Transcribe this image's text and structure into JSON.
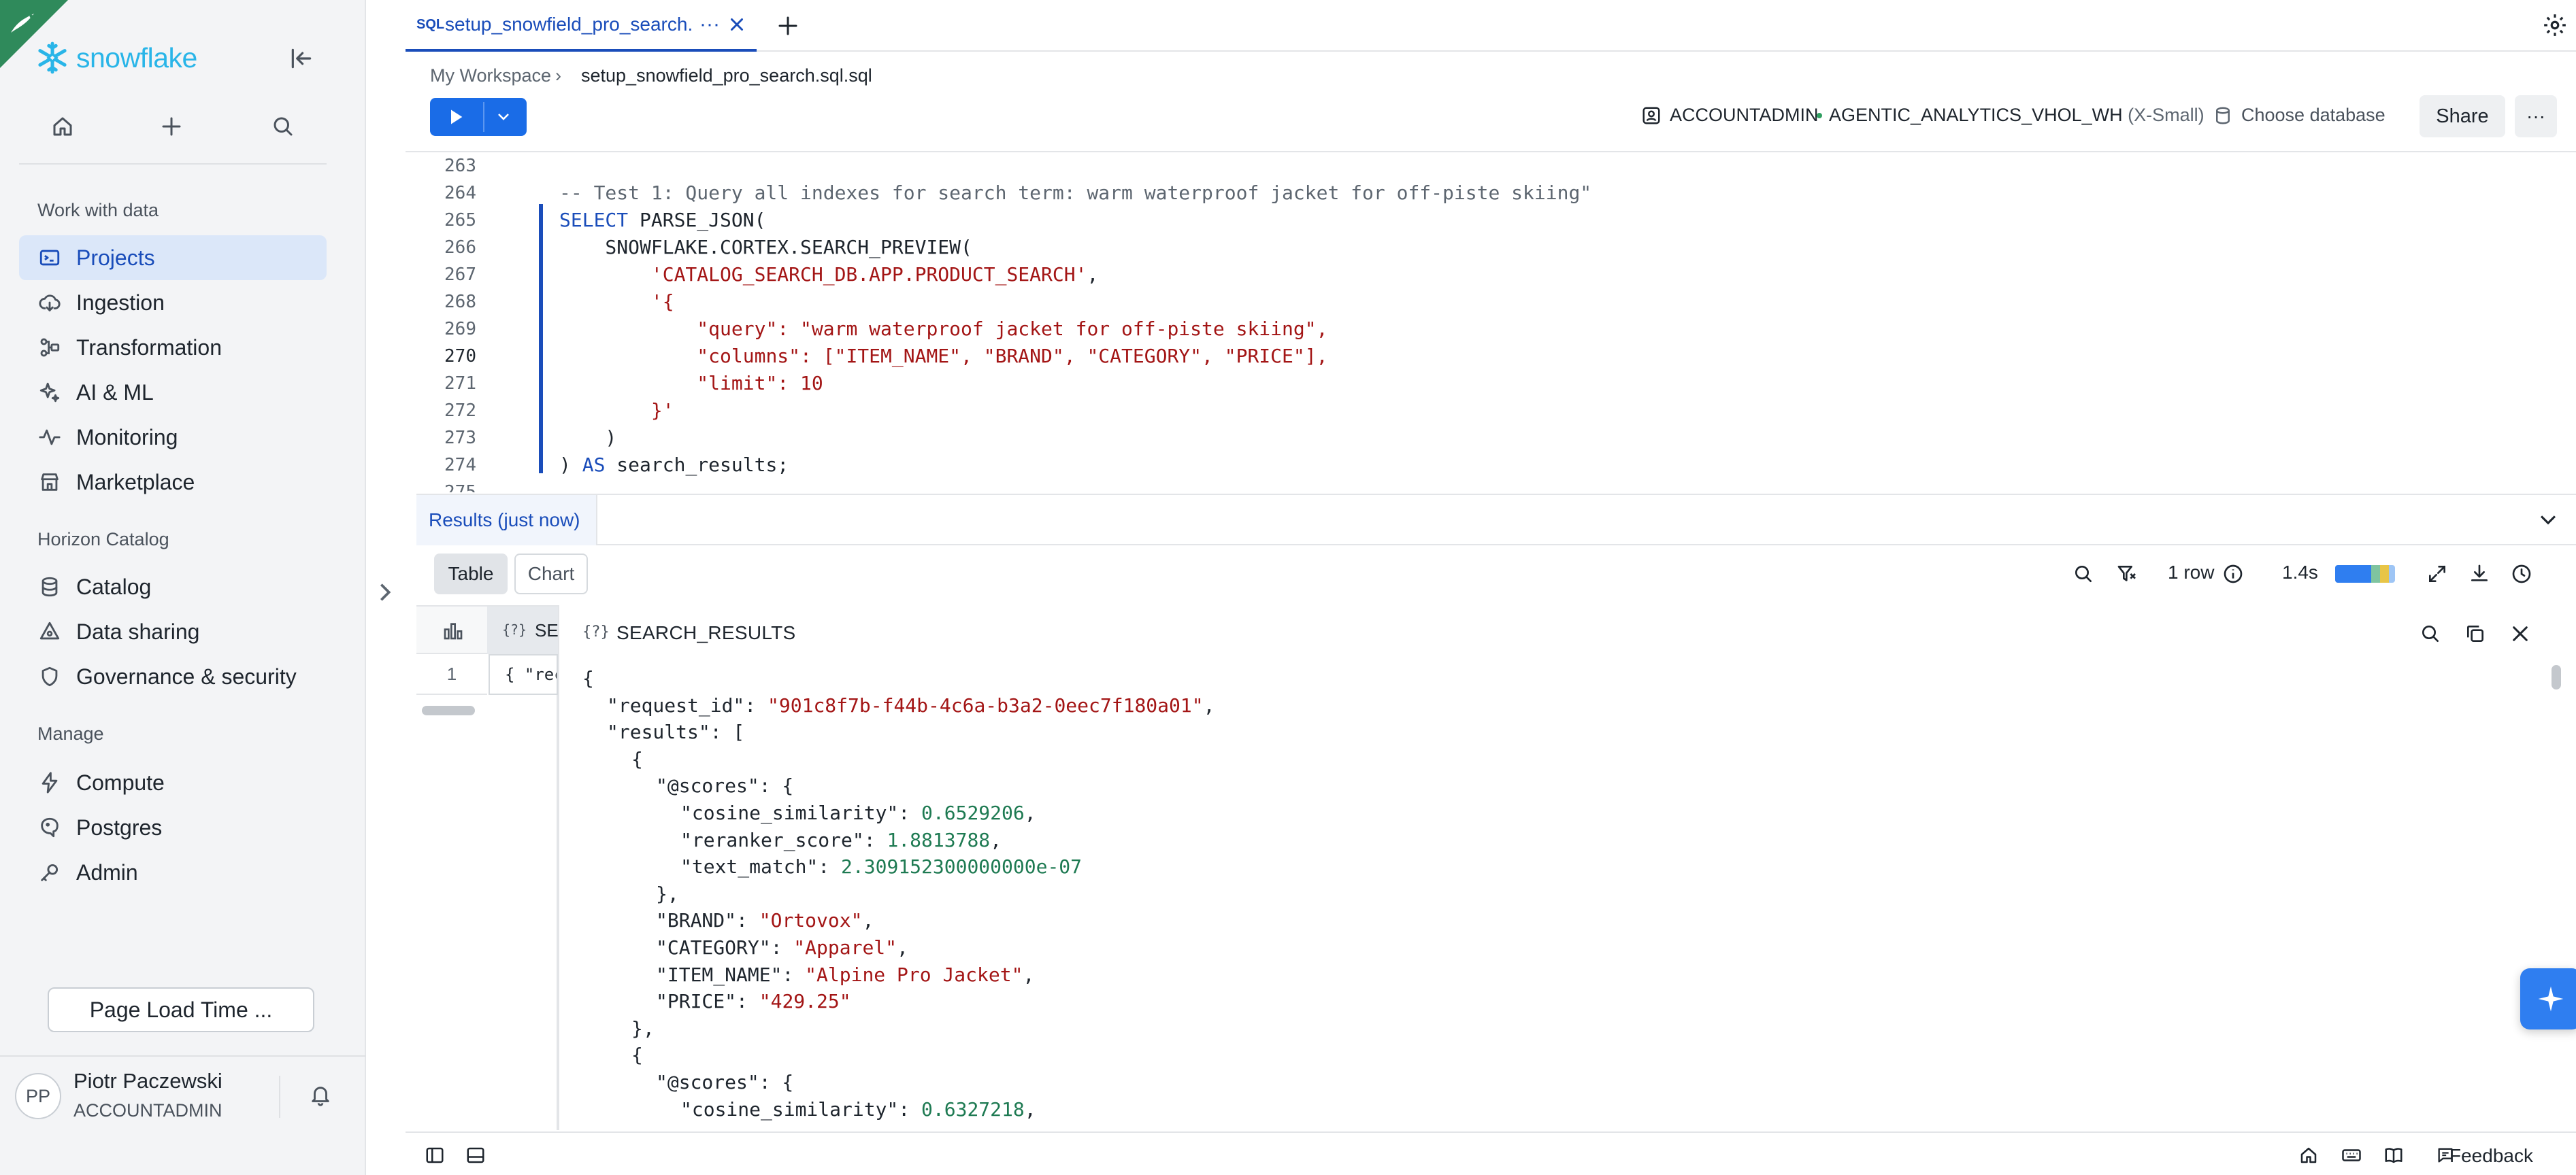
{
  "app": {
    "brand": "snowflake"
  },
  "sidebar": {
    "sections": [
      {
        "title": "Work with data",
        "items": [
          {
            "label": "Projects",
            "icon": "projects-icon",
            "active": true
          },
          {
            "label": "Ingestion",
            "icon": "ingestion-icon"
          },
          {
            "label": "Transformation",
            "icon": "transformation-icon"
          },
          {
            "label": "AI & ML",
            "icon": "ai-ml-icon"
          },
          {
            "label": "Monitoring",
            "icon": "monitoring-icon"
          },
          {
            "label": "Marketplace",
            "icon": "marketplace-icon"
          }
        ]
      },
      {
        "title": "Horizon Catalog",
        "items": [
          {
            "label": "Catalog",
            "icon": "catalog-icon"
          },
          {
            "label": "Data sharing",
            "icon": "data-sharing-icon"
          },
          {
            "label": "Governance & security",
            "icon": "shield-icon"
          }
        ]
      },
      {
        "title": "Manage",
        "items": [
          {
            "label": "Compute",
            "icon": "compute-icon"
          },
          {
            "label": "Postgres",
            "icon": "postgres-icon"
          },
          {
            "label": "Admin",
            "icon": "admin-icon"
          }
        ]
      }
    ],
    "page_load_button": "Page Load Time ...",
    "user": {
      "initials": "PP",
      "name": "Piotr Paczewski",
      "role": "ACCOUNTADMIN"
    }
  },
  "tab": {
    "badge": "SQL",
    "label": "setup_snowfield_pro_search.",
    "more": "···"
  },
  "breadcrumb": {
    "root": "My Workspace",
    "sep": "›",
    "file": "setup_snowfield_pro_search.sql.sql"
  },
  "toolbar": {
    "role": "ACCOUNTADMIN",
    "warehouse": "AGENTIC_ANALYTICS_VHOL_WH",
    "warehouse_size": "(X-Small)",
    "database": "Choose database",
    "share": "Share",
    "more": "···"
  },
  "editor": {
    "current_line": "270",
    "lines": [
      {
        "n": "263",
        "text": ""
      },
      {
        "n": "264",
        "text": "-- Test 1: Query all indexes for search term: warm waterproof jacket for off-piste skiing\""
      },
      {
        "n": "265",
        "kw": "SELECT",
        "text": " PARSE_JSON("
      },
      {
        "n": "266",
        "text": "    SNOWFLAKE.CORTEX.SEARCH_PREVIEW("
      },
      {
        "n": "267",
        "pre": "        ",
        "str": "'CATALOG_SEARCH_DB.APP.PRODUCT_SEARCH'",
        "post": ","
      },
      {
        "n": "268",
        "pre": "        ",
        "str": "'{"
      },
      {
        "n": "269",
        "pre": "            ",
        "str": "\"query\": \"warm waterproof jacket for off-piste skiing\","
      },
      {
        "n": "270",
        "pre": "            ",
        "str": "\"columns\": [\"ITEM_NAME\", \"BRAND\", \"CATEGORY\", \"PRICE\"],"
      },
      {
        "n": "271",
        "pre": "            ",
        "str": "\"limit\": 10"
      },
      {
        "n": "272",
        "pre": "        ",
        "str": "}'"
      },
      {
        "n": "273",
        "text": "    )"
      },
      {
        "n": "274",
        "pre": ") ",
        "kw": "AS",
        "text": " search_results;"
      },
      {
        "n": "275",
        "text": ""
      }
    ]
  },
  "results": {
    "tab_label": "Results (just now)",
    "view_table": "Table",
    "view_chart": "Chart",
    "rows": "1 row",
    "duration": "1.4s",
    "column_header": "SE",
    "row_number": "1",
    "cell_preview": "{ \"rec",
    "json_title": "SEARCH_RESULTS",
    "json_lines": [
      {
        "i": 0,
        "p": "{"
      },
      {
        "i": 1,
        "k": "\"request_id\"",
        "s": "\"901c8f7b-f44b-4c6a-b3a2-0eec7f180a01\"",
        "t": ","
      },
      {
        "i": 1,
        "k": "\"results\"",
        "p": ": ["
      },
      {
        "i": 2,
        "p": "{"
      },
      {
        "i": 3,
        "k": "\"@scores\"",
        "p": ": {"
      },
      {
        "i": 4,
        "k": "\"cosine_similarity\"",
        "n": "0.6529206",
        "t": ","
      },
      {
        "i": 4,
        "k": "\"reranker_score\"",
        "n": "1.8813788",
        "t": ","
      },
      {
        "i": 4,
        "k": "\"text_match\"",
        "n": "2.309152300000000e-07"
      },
      {
        "i": 3,
        "p": "},"
      },
      {
        "i": 3,
        "k": "\"BRAND\"",
        "s": "\"Ortovox\"",
        "t": ","
      },
      {
        "i": 3,
        "k": "\"CATEGORY\"",
        "s": "\"Apparel\"",
        "t": ","
      },
      {
        "i": 3,
        "k": "\"ITEM_NAME\"",
        "s": "\"Alpine Pro Jacket\"",
        "t": ","
      },
      {
        "i": 3,
        "k": "\"PRICE\"",
        "s": "\"429.25\""
      },
      {
        "i": 2,
        "p": "},"
      },
      {
        "i": 2,
        "p": "{"
      },
      {
        "i": 3,
        "k": "\"@scores\"",
        "p": ": {"
      },
      {
        "i": 4,
        "k": "\"cosine_similarity\"",
        "n": "0.6327218",
        "t": ","
      }
    ]
  },
  "footer": {
    "feedback": "Feedback"
  },
  "colors": {
    "accent": "#1a6ce7",
    "brand": "#29b5e8",
    "string": "#a31515",
    "number": "#1e7a52"
  }
}
